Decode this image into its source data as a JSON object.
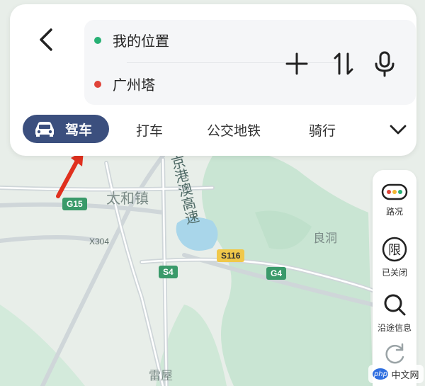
{
  "route": {
    "origin": "我的位置",
    "destination": "广州塔"
  },
  "route_actions": {
    "add_icon": "plus-icon",
    "swap_icon": "swap-vertical-icon",
    "voice_icon": "microphone-icon"
  },
  "tabs": {
    "active": "驾车",
    "items": [
      "打车",
      "公交地铁",
      "骑行"
    ]
  },
  "side_panel": {
    "traffic_label": "路况",
    "restrict_glyph": "限",
    "restrict_label": "已关闭",
    "search_label": "沿途信息"
  },
  "map": {
    "places": [
      "太和镇",
      "良洞",
      "雷屋"
    ],
    "road_name": "京港澳高速",
    "shields": {
      "g15": "G15",
      "x304": "X304",
      "s116": "S116",
      "s4": "S4",
      "g4": "G4"
    }
  },
  "watermark": {
    "logo": "php",
    "text": "中文网"
  },
  "colors": {
    "accent": "#3b4f7e",
    "origin_dot": "#27b074",
    "destination_dot": "#e0443a",
    "annotation_arrow": "#e0301e"
  }
}
